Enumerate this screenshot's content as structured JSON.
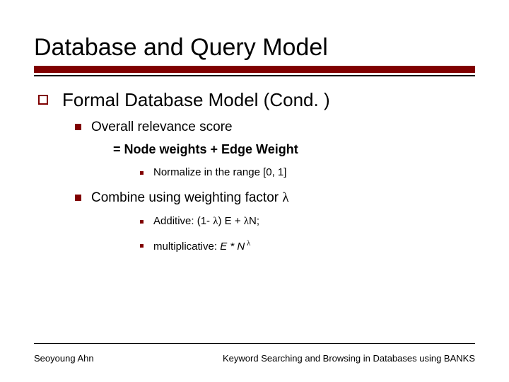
{
  "title": "Database and Query Model",
  "section": "Formal Database Model (Cond. )",
  "items": {
    "overall": {
      "label": "Overall relevance score",
      "formula": "= Node weights + Edge Weight",
      "normalize": "Normalize in the range [0, 1]"
    },
    "combine": {
      "label_pre": "Combine using weighting factor ",
      "lambda": "λ",
      "additive_pre": "Additive: (1- ",
      "additive_mid": ") E + ",
      "additive_post": "N;",
      "mult_pre": "multiplicative: ",
      "mult_expr_E": "E * N",
      "mult_sup": " λ"
    }
  },
  "footer": {
    "left": "Seoyoung Ahn",
    "right": "Keyword Searching and Browsing in Databases using BANKS"
  }
}
